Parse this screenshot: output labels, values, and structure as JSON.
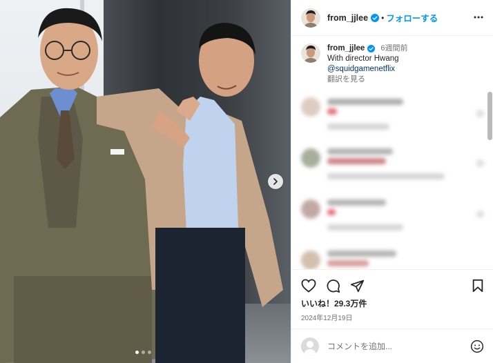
{
  "post": {
    "username": "from_jjlee",
    "follow_label": "フォローする",
    "separator": "•",
    "more_icon": "more-horizontal-icon"
  },
  "caption": {
    "username": "from_jjlee",
    "time_ago": "6週間前",
    "text": "With director Hwang",
    "mention": "@squidgamenetflix",
    "translate_label": "翻訳を見る"
  },
  "actions": {
    "icons": [
      "heart-icon",
      "comment-icon",
      "share-icon",
      "bookmark-icon"
    ],
    "likes_label": "いいね！29.3万件",
    "date": "2024年12月19日"
  },
  "comment_box": {
    "placeholder": "コメントを追加...",
    "emoji_icon": "smile-icon"
  },
  "carousel": {
    "next_icon": "chevron-right-icon",
    "slide_count": 3,
    "active_slide": 1
  },
  "colors": {
    "accent": "#0095f6",
    "text": "#262626",
    "muted": "#737373",
    "border": "#efefef",
    "link": "#00376b"
  }
}
